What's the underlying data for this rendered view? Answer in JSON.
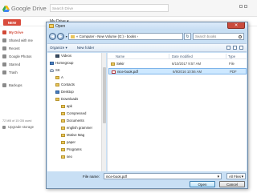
{
  "drive": {
    "logo_text_google": "Google",
    "logo_text_drive": "Drive",
    "search_placeholder": "Search Drive",
    "new_button": "NEW",
    "breadcrumb": "My Drive ▾",
    "sidebar": [
      {
        "label": "My Drive",
        "icon": "folder-icon",
        "active": true
      },
      {
        "label": "Shared with me",
        "icon": "people-icon",
        "active": false
      },
      {
        "label": "Recent",
        "icon": "clock-icon",
        "active": false
      },
      {
        "label": "Google Photos",
        "icon": "photos-icon",
        "active": false
      },
      {
        "label": "Starred",
        "icon": "star-icon",
        "active": false
      },
      {
        "label": "Trash",
        "icon": "trash-icon",
        "active": false
      },
      {
        "label": "Backups",
        "icon": "backup-icon",
        "active": false
      }
    ],
    "storage_text": "72 MB of 15 GB used",
    "upgrade_label": "Upgrade storage"
  },
  "dialog": {
    "title": "Open",
    "close_label": "✕",
    "address_path": "« Computer › New Volume (G:) › books ›",
    "search_placeholder": "Search books",
    "toolbar": {
      "organize_label": "Organize ▾",
      "new_folder_label": "New folder"
    },
    "nav_tree": [
      {
        "label": "Videos",
        "icon": "video-icon",
        "indent": 1
      },
      {
        "label": "Homegroup",
        "icon": "homegroup-icon",
        "indent": 0
      },
      {
        "label": "SK",
        "icon": "user-icon",
        "indent": 0
      },
      {
        "label": "A",
        "icon": "folder-icon",
        "indent": 1
      },
      {
        "label": "Contacts",
        "icon": "folder-icon",
        "indent": 1
      },
      {
        "label": "Desktop",
        "icon": "folder-icon",
        "indent": 1
      },
      {
        "label": "Downloads",
        "icon": "folder-icon",
        "indent": 1
      },
      {
        "label": "apk",
        "icon": "folder-icon",
        "indent": 2
      },
      {
        "label": "Compressed",
        "icon": "folder-icon",
        "indent": 2
      },
      {
        "label": "Documents",
        "icon": "folder-icon",
        "indent": 2
      },
      {
        "label": "english grammer",
        "icon": "folder-icon",
        "indent": 2
      },
      {
        "label": "Motive Mag",
        "icon": "folder-icon",
        "indent": 2
      },
      {
        "label": "paper",
        "icon": "folder-icon",
        "indent": 2
      },
      {
        "label": "Programs",
        "icon": "folder-icon",
        "indent": 2
      },
      {
        "label": "seo",
        "icon": "folder-icon",
        "indent": 2
      }
    ],
    "columns": {
      "name": "Name",
      "date": "Date modified",
      "type": "Type"
    },
    "files": [
      {
        "name": "Sekir",
        "date": "6/10/2017 9:57 AM",
        "type": "File",
        "icon": "folder-icon",
        "selected": false
      },
      {
        "name": "nice-book.pdf",
        "date": "6/9/2016 10:56 AM",
        "type": "PDF",
        "icon": "pdf-icon",
        "selected": true
      }
    ],
    "filename_label": "File name:",
    "filename_value": "nice-book.pdf",
    "filetype_value": "All Files",
    "open_label": "Open",
    "cancel_label": "Cancel"
  }
}
